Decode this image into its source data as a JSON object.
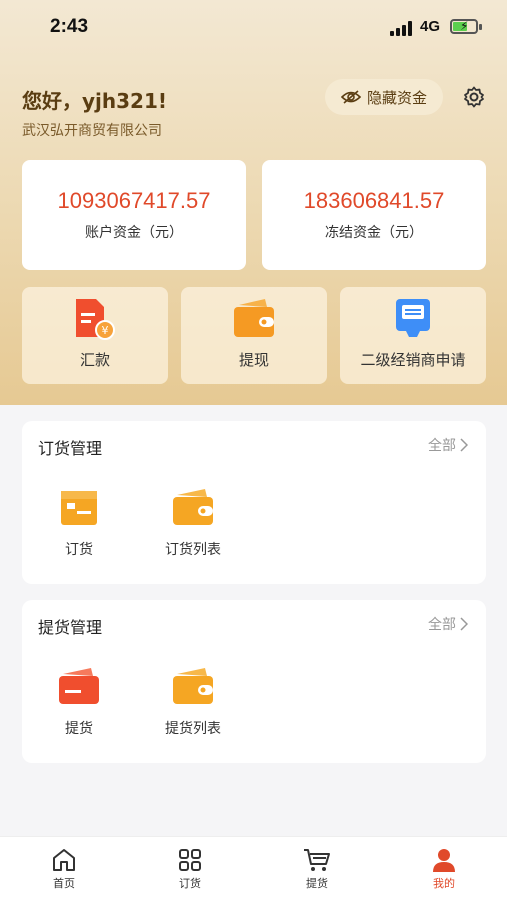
{
  "status": {
    "time": "2:43",
    "network": "4G"
  },
  "header": {
    "greeting": "您好，yjh321!",
    "company": "武汉弘开商贸有限公司",
    "hide_funds_label": "隐藏资金"
  },
  "funds": [
    {
      "amount": "1093067417.57",
      "label": "账户资金（元）"
    },
    {
      "amount": "183606841.57",
      "label": "冻结资金（元）"
    }
  ],
  "actions": [
    {
      "label": "汇款",
      "icon": "remittance-icon"
    },
    {
      "label": "提现",
      "icon": "wallet-icon"
    },
    {
      "label": "二级经销商申请",
      "icon": "application-icon"
    }
  ],
  "order_section": {
    "title": "订货管理",
    "more": "全部",
    "items": [
      {
        "label": "订货",
        "icon": "order-box-icon"
      },
      {
        "label": "订货列表",
        "icon": "order-list-wallet-icon"
      }
    ]
  },
  "pickup_section": {
    "title": "提货管理",
    "more": "全部",
    "items": [
      {
        "label": "提货",
        "icon": "pickup-wallet-icon"
      },
      {
        "label": "提货列表",
        "icon": "pickup-list-wallet-icon"
      }
    ]
  },
  "tabs": [
    {
      "label": "首页",
      "icon": "home-icon"
    },
    {
      "label": "订货",
      "icon": "grid-icon"
    },
    {
      "label": "提货",
      "icon": "cart-icon"
    },
    {
      "label": "我的",
      "icon": "user-icon",
      "active": true
    }
  ],
  "colors": {
    "accent": "#e0492a",
    "gold_text": "#5a3d12",
    "orange": "#f5a623"
  }
}
